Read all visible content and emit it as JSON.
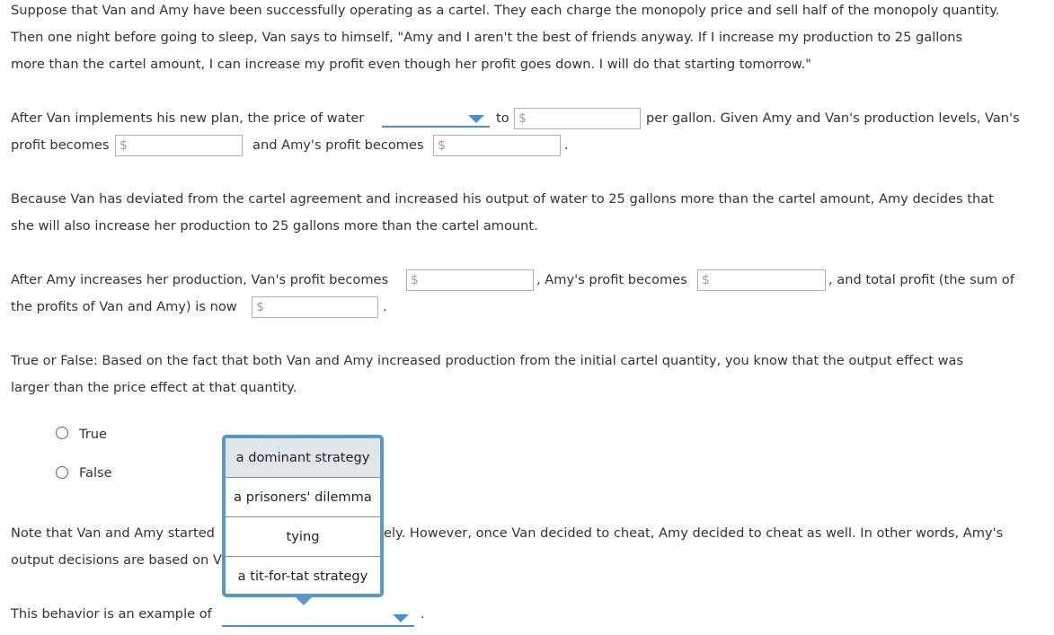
{
  "intro": [
    "Suppose that Van and Amy have been successfully operating as a cartel. They each charge the monopoly price and sell half of the monopoly quantity.",
    "Then one night before going to sleep, Van says to himself, \"Amy and I aren't the best of friends anyway. If I increase my production to 25 gallons",
    "more than the cartel amount, I can increase my profit even though her profit goes down. I will do that starting tomorrow.\""
  ],
  "q1": {
    "a": "After Van implements his new plan, the price of water",
    "to": "to",
    "b": "per gallon. Given Amy and Van's production levels, Van's",
    "c": "profit becomes",
    "d": "and Amy's profit becomes",
    "end": ".",
    "currency": "$"
  },
  "context": [
    "Because Van has deviated from the cartel agreement and increased his output of water to 25 gallons more than the cartel amount, Amy decides that",
    "she will also increase her production to 25 gallons more than the cartel amount."
  ],
  "q2": {
    "a": "After Amy increases her production, Van's profit becomes",
    "b": ", Amy's profit becomes",
    "c": ", and total profit (the sum of",
    "d": "the profits of Van and Amy) is now",
    "end": "."
  },
  "q3": {
    "lines": [
      "True or False: Based on the fact that both Van and Amy increased production from the initial cartel quantity, you know that the output effect was",
      "larger than the price effect at that quantity."
    ],
    "options": [
      "True",
      "False"
    ]
  },
  "note": {
    "l1a": "Note that Van and Amy started",
    "l1b": "ely. However, once Van decided to cheat, Amy decided to cheat as well. In other words, Amy's",
    "l2": "output decisions are based on V"
  },
  "q4": {
    "text": "This behavior is an example of",
    "end": "."
  },
  "dropdown_menu": {
    "options": [
      "a dominant strategy",
      "a prisoners' dilemma",
      "tying",
      "a tit-for-tat strategy"
    ],
    "highlighted": "a dominant strategy"
  }
}
